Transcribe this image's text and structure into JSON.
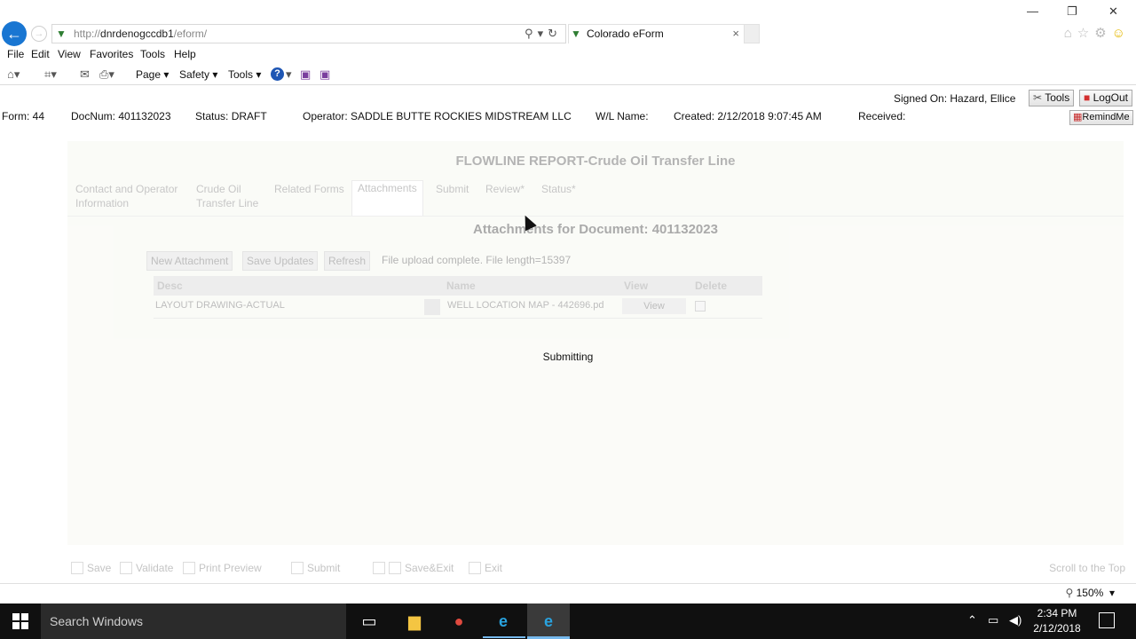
{
  "browser": {
    "url_dim": "http://",
    "url_main": "dnrdenogccdb1",
    "url_path": "/eform/",
    "tab_title": "Colorado eForm",
    "tab_close": "×",
    "menu": [
      "File",
      "Edit",
      "View",
      "Favorites",
      "Tools",
      "Help"
    ],
    "cmd": {
      "page": "Page ▾",
      "safety": "Safety ▾",
      "tools": "Tools ▾"
    }
  },
  "header": {
    "signed_on": "Signed On: Hazard, Ellice",
    "tools_btn": "Tools",
    "logout_btn": "LogOut",
    "remind_btn": "RemindMe",
    "form": "Form: 44",
    "docnum": "DocNum: 401132023",
    "status": "Status: DRAFT",
    "operator": "Operator: SADDLE BUTTE ROCKIES MIDSTREAM LLC",
    "wl_name": "W/L Name:",
    "created": "Created: 2/12/2018 9:07:45 AM",
    "received": "Received:"
  },
  "form": {
    "title": "FLOWLINE REPORT-Crude Oil Transfer Line",
    "tabs": [
      {
        "line1": "Contact and Operator",
        "line2": "Information"
      },
      {
        "line1": "Crude Oil",
        "line2": "Transfer Line"
      },
      {
        "line1": "Related Forms",
        "line2": ""
      },
      {
        "line1": "Attachments",
        "line2": ""
      },
      {
        "line1": "Submit",
        "line2": ""
      },
      {
        "line1": "Review*",
        "line2": ""
      },
      {
        "line1": "Status*",
        "line2": ""
      }
    ],
    "attachments_heading": "Attachments for Document: 401132023",
    "buttons": {
      "new": "New Attachment",
      "save": "Save Updates",
      "refresh": "Refresh"
    },
    "upload_message": "File upload complete. File length=15397",
    "grid": {
      "headers": [
        "Desc",
        "Name",
        "View",
        "Delete"
      ],
      "rows": [
        {
          "desc": "LAYOUT DRAWING-ACTUAL",
          "name": "WELL LOCATION MAP - 442696.pd",
          "view": "View"
        }
      ]
    },
    "bottom_bar": {
      "save": "Save",
      "validate": "Validate",
      "print": "Print Preview",
      "submit": "Submit",
      "saveexit": "Save&Exit",
      "exit": "Exit",
      "scroll_top": "Scroll to the Top"
    }
  },
  "overlay": {
    "message": "Submitting"
  },
  "statusbar": {
    "zoom": "150%"
  },
  "taskbar": {
    "search": "Search Windows",
    "time": "2:34 PM",
    "date": "2/12/2018"
  }
}
